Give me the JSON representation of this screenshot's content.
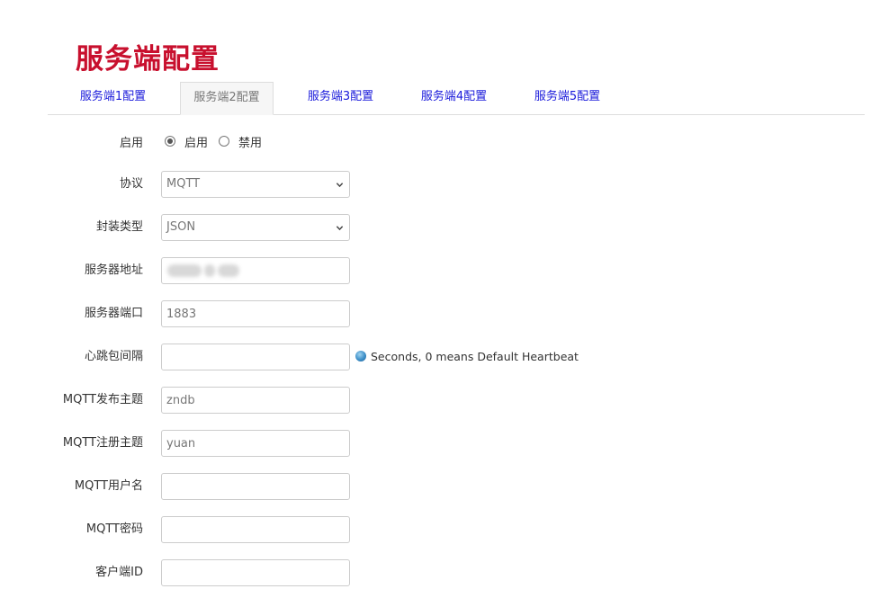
{
  "page_title": "服务端配置",
  "tabs": [
    {
      "label": "服务端1配置",
      "active": false
    },
    {
      "label": "服务端2配置",
      "active": true
    },
    {
      "label": "服务端3配置",
      "active": false
    },
    {
      "label": "服务端4配置",
      "active": false
    },
    {
      "label": "服务端5配置",
      "active": false
    }
  ],
  "form": {
    "enable": {
      "label": "启用",
      "options": [
        "启用",
        "禁用"
      ],
      "selected": "启用"
    },
    "protocol": {
      "label": "协议",
      "value": "MQTT"
    },
    "encap_type": {
      "label": "封装类型",
      "value": "JSON"
    },
    "server_address": {
      "label": "服务器地址",
      "value": ""
    },
    "server_port": {
      "label": "服务器端口",
      "value": "1883"
    },
    "heartbeat": {
      "label": "心跳包间隔",
      "value": "",
      "hint": "Seconds, 0 means Default Heartbeat"
    },
    "publish_topic": {
      "label": "MQTT发布主题",
      "value": "zndb"
    },
    "register_topic": {
      "label": "MQTT注册主题",
      "value": "yuan"
    },
    "username": {
      "label": "MQTT用户名",
      "value": ""
    },
    "password": {
      "label": "MQTT密码",
      "value": ""
    },
    "client_id": {
      "label": "客户端ID",
      "value": ""
    }
  },
  "colors": {
    "title": "#c8102e",
    "tab_link": "#1a1adb",
    "tab_active_text": "#777777"
  },
  "icons": {
    "hint": "info-circle-icon",
    "select_arrow": "chevron-down-icon"
  }
}
